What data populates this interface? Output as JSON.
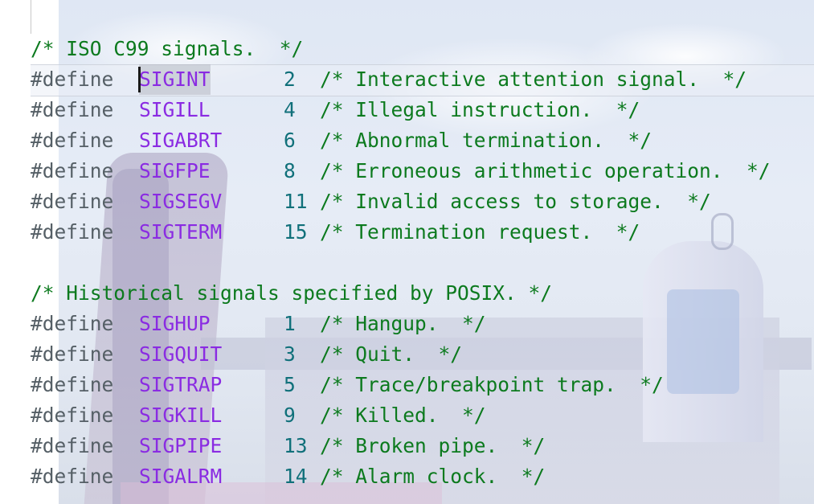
{
  "editor": {
    "lines": [
      {
        "kind": "comment",
        "text": "/* ISO C99 signals.  */"
      },
      {
        "kind": "define",
        "directive": "#define",
        "name": "SIGINT",
        "value": "2",
        "comment": "/* Interactive attention signal.  */"
      },
      {
        "kind": "define",
        "directive": "#define",
        "name": "SIGILL",
        "value": "4",
        "comment": "/* Illegal instruction.  */"
      },
      {
        "kind": "define",
        "directive": "#define",
        "name": "SIGABRT",
        "value": "6",
        "comment": "/* Abnormal termination.  */"
      },
      {
        "kind": "define",
        "directive": "#define",
        "name": "SIGFPE",
        "value": "8",
        "comment": "/* Erroneous arithmetic operation.  */"
      },
      {
        "kind": "define",
        "directive": "#define",
        "name": "SIGSEGV",
        "value": "11",
        "comment": "/* Invalid access to storage.  */"
      },
      {
        "kind": "define",
        "directive": "#define",
        "name": "SIGTERM",
        "value": "15",
        "comment": "/* Termination request.  */"
      },
      {
        "kind": "blank"
      },
      {
        "kind": "comment",
        "text": "/* Historical signals specified by POSIX. */"
      },
      {
        "kind": "define",
        "directive": "#define",
        "name": "SIGHUP",
        "value": "1",
        "comment": "/* Hangup.  */"
      },
      {
        "kind": "define",
        "directive": "#define",
        "name": "SIGQUIT",
        "value": "3",
        "comment": "/* Quit.  */"
      },
      {
        "kind": "define",
        "directive": "#define",
        "name": "SIGTRAP",
        "value": "5",
        "comment": "/* Trace/breakpoint trap.  */"
      },
      {
        "kind": "define",
        "directive": "#define",
        "name": "SIGKILL",
        "value": "9",
        "comment": "/* Killed.  */"
      },
      {
        "kind": "define",
        "directive": "#define",
        "name": "SIGPIPE",
        "value": "13",
        "comment": "/* Broken pipe.  */"
      },
      {
        "kind": "define",
        "directive": "#define",
        "name": "SIGALRM",
        "value": "14",
        "comment": "/* Alarm clock.  */"
      }
    ],
    "selected_token": "SIGINT",
    "colors": {
      "directive": "#555f66",
      "macro_name": "#8a2be2",
      "number": "#10707a",
      "comment": "#0c7a1e"
    }
  }
}
